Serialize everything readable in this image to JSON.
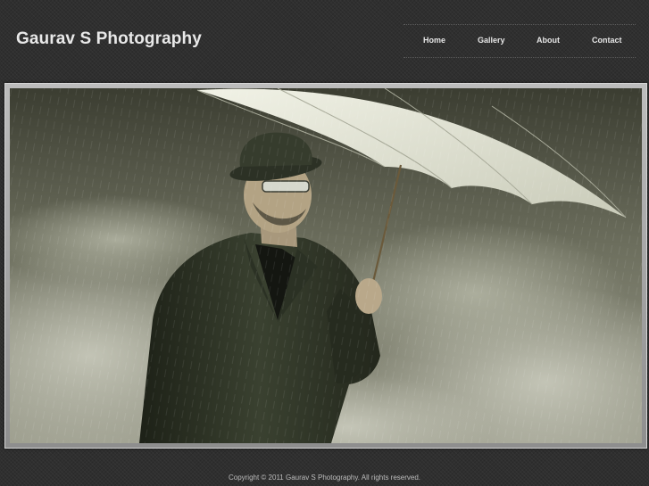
{
  "site": {
    "title": "Gaurav S Photography"
  },
  "nav": {
    "items": [
      {
        "label": "Home"
      },
      {
        "label": "Gallery"
      },
      {
        "label": "About"
      },
      {
        "label": "Contact"
      }
    ]
  },
  "hero": {
    "subject": "man in suit and bowler hat holding white umbrella against stormy clouds in rain"
  },
  "footer": {
    "copyright": "Copyright © 2011 Gaurav S Photography. All rights reserved."
  }
}
